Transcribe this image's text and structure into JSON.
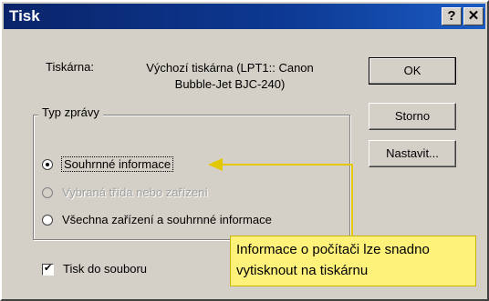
{
  "window": {
    "title": "Tisk",
    "help_label": "?",
    "close_label": "✕"
  },
  "printer": {
    "label": "Tiskárna:",
    "value_line1": "Výchozí tiskárna (LPT1:: Canon",
    "value_line2": "Bubble-Jet BJC-240)"
  },
  "report_group": {
    "title": "Typ zprávy",
    "options": [
      {
        "label": "Souhrnné informace",
        "selected": true,
        "enabled": true
      },
      {
        "label": "Vybraná třída nebo zařízení",
        "selected": false,
        "enabled": false
      },
      {
        "label": "Všechna zařízení a souhrnné informace",
        "selected": false,
        "enabled": true
      }
    ]
  },
  "print_to_file": {
    "label": "Tisk do souboru",
    "checked": true
  },
  "buttons": {
    "ok": "OK",
    "cancel": "Storno",
    "settings": "Nastavit..."
  },
  "annotation": {
    "line1": "Informace o počítači lze snadno",
    "line2": "vytisknout na tiskárnu"
  },
  "colors": {
    "annotation_bg": "#fff27a",
    "arrow": "#e3c800",
    "titlebar": "#0a246a"
  }
}
